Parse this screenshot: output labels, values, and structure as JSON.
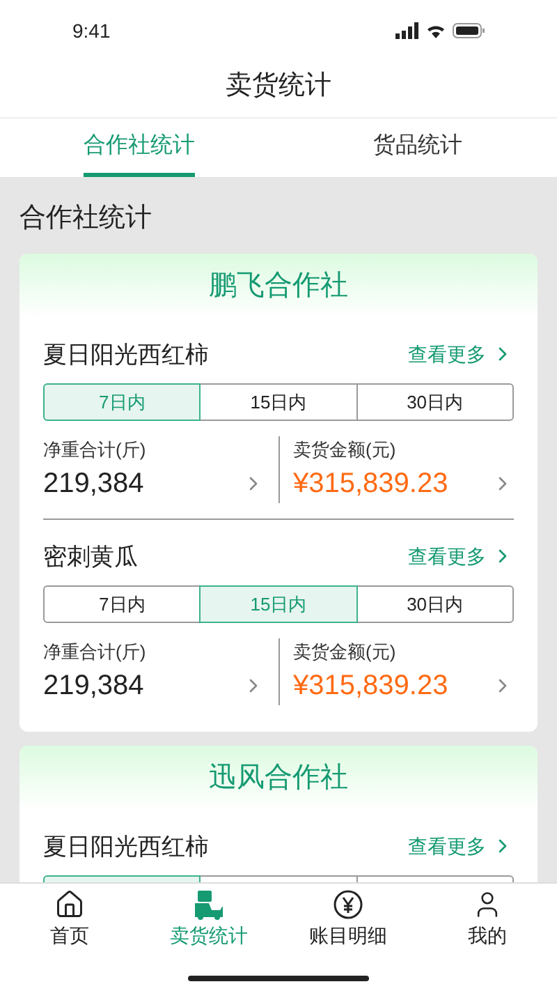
{
  "status_bar": {
    "time": "9:41"
  },
  "header": {
    "title": "卖货统计"
  },
  "tabs": [
    {
      "label": "合作社统计",
      "selected": true
    },
    {
      "label": "货品统计",
      "selected": false
    }
  ],
  "section_title": "合作社统计",
  "cooperatives": [
    {
      "name": "鹏飞合作社",
      "products": [
        {
          "name": "夏日阳光西红柿",
          "more": "查看更多",
          "periods": [
            {
              "label": "7日内",
              "selected": true
            },
            {
              "label": "15日内",
              "selected": false
            },
            {
              "label": "30日内",
              "selected": false
            }
          ],
          "weight_label": "净重合计(斤)",
          "weight": "219,384",
          "amount_label": "卖货金额(元)",
          "amount": "¥315,839.23"
        },
        {
          "name": "密刺黄瓜",
          "more": "查看更多",
          "periods": [
            {
              "label": "7日内",
              "selected": false
            },
            {
              "label": "15日内",
              "selected": true
            },
            {
              "label": "30日内",
              "selected": false
            }
          ],
          "weight_label": "净重合计(斤)",
          "weight": "219,384",
          "amount_label": "卖货金额(元)",
          "amount": "¥315,839.23"
        }
      ]
    },
    {
      "name": "迅风合作社",
      "products": [
        {
          "name": "夏日阳光西红柿",
          "more": "查看更多",
          "periods": [
            {
              "selected": true
            },
            {
              "selected": false
            },
            {
              "selected": false
            }
          ]
        }
      ]
    }
  ],
  "nav": [
    {
      "label": "首页",
      "kind": "home",
      "selected": false
    },
    {
      "label": "卖货统计",
      "kind": "sales",
      "selected": true
    },
    {
      "label": "账目明细",
      "kind": "ledger",
      "selected": false
    },
    {
      "label": "我的",
      "kind": "me",
      "selected": false
    }
  ]
}
